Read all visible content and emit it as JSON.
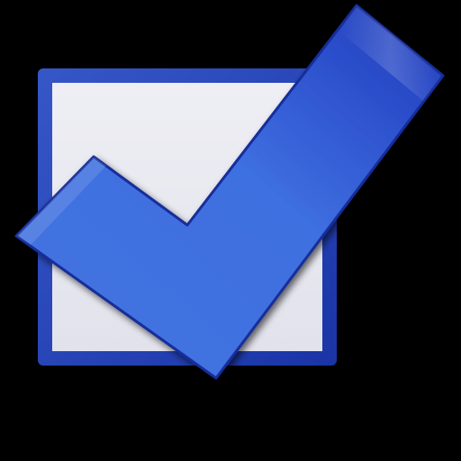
{
  "icon": {
    "name": "checked-checkbox-icon",
    "state": "checked"
  },
  "colors": {
    "background": "#000000",
    "box_border": "#1f3fb0",
    "box_fill": "#e8e8f0",
    "check_light": "#5a86e6",
    "check_mid": "#3a66dc",
    "check_dark": "#1f3fc4"
  }
}
